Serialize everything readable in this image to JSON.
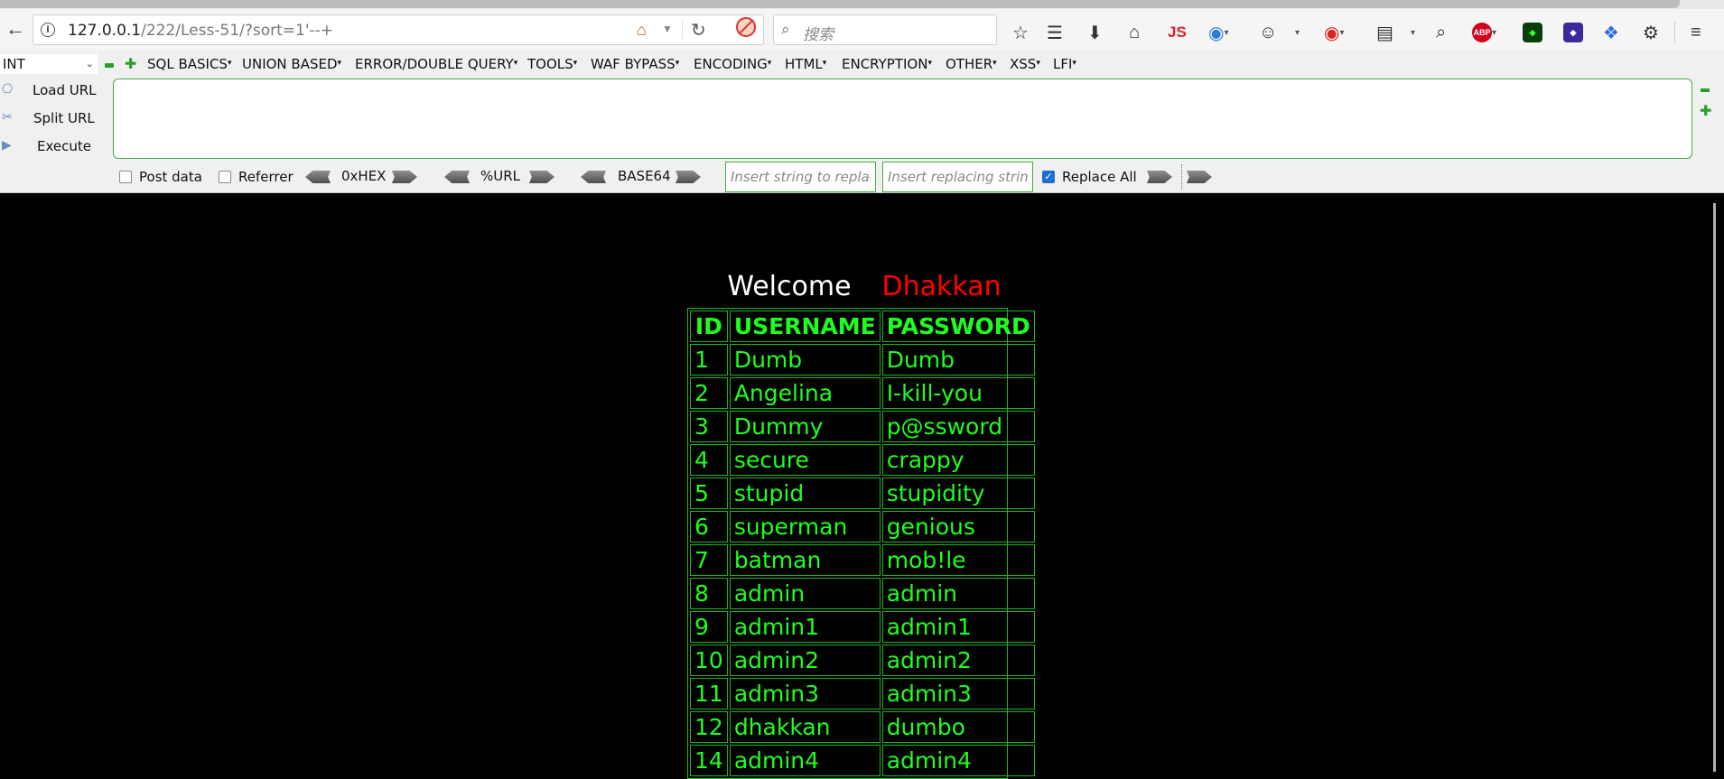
{
  "browser": {
    "url_host": "127.0.0.1",
    "url_path": "/222/Less-51/?sort=1'--+",
    "search_placeholder": "搜索",
    "toolbar_js": "JS",
    "toolbar_abp": "ABP"
  },
  "hackbar": {
    "mode": "INT",
    "menus": [
      "SQL BASICS",
      "UNION BASED",
      "ERROR/DOUBLE QUERY",
      "TOOLS",
      "WAF BYPASS",
      "ENCODING",
      "HTML",
      "ENCRYPTION",
      "OTHER",
      "XSS",
      "LFI"
    ],
    "load_url": "Load URL",
    "split_url": "Split URL",
    "execute": "Execute",
    "post_data": "Post data",
    "referrer": "Referrer",
    "hex": "0xHEX",
    "urlenc": "%URL",
    "base64": "BASE64",
    "replace_from_placeholder": "Insert string to replace",
    "replace_to_placeholder": "Insert replacing string",
    "replace_all": "Replace All",
    "post_data_checked": false,
    "referrer_checked": false,
    "replace_all_checked": true
  },
  "page": {
    "welcome": "Welcome",
    "name": "Dhakkan",
    "headers": [
      "ID",
      "USERNAME",
      "PASSWORD"
    ],
    "rows": [
      [
        "1",
        "Dumb",
        "Dumb"
      ],
      [
        "2",
        "Angelina",
        "I-kill-you"
      ],
      [
        "3",
        "Dummy",
        "p@ssword"
      ],
      [
        "4",
        "secure",
        "crappy"
      ],
      [
        "5",
        "stupid",
        "stupidity"
      ],
      [
        "6",
        "superman",
        "genious"
      ],
      [
        "7",
        "batman",
        "mob!le"
      ],
      [
        "8",
        "admin",
        "admin"
      ],
      [
        "9",
        "admin1",
        "admin1"
      ],
      [
        "10",
        "admin2",
        "admin2"
      ],
      [
        "11",
        "admin3",
        "admin3"
      ],
      [
        "12",
        "dhakkan",
        "dumbo"
      ],
      [
        "14",
        "admin4",
        "admin4"
      ]
    ]
  },
  "colors": {
    "table_text": "#1fff1f",
    "table_border": "#1fb51f",
    "name": "#ff0000",
    "background": "#000000"
  }
}
